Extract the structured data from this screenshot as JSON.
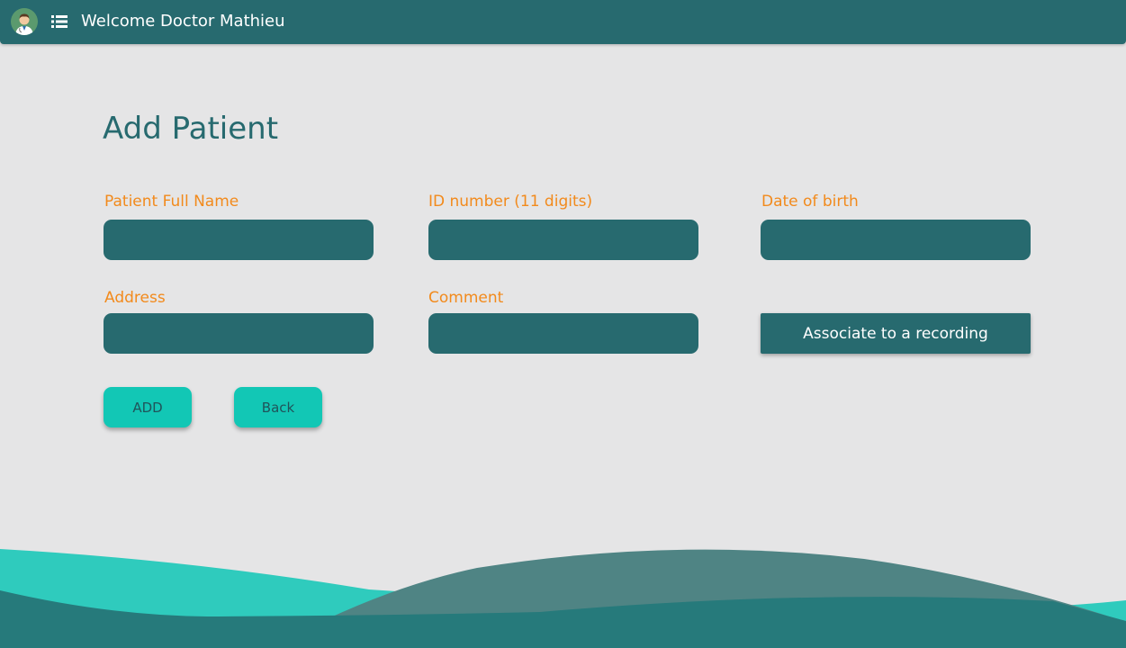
{
  "header": {
    "welcome_text": "Welcome Doctor Mathieu",
    "avatar_icon": "doctor-avatar-icon",
    "menu_icon": "list-menu-icon"
  },
  "main": {
    "title": "Add Patient",
    "fields": {
      "full_name": {
        "label": "Patient Full Name",
        "value": ""
      },
      "id_number": {
        "label": "ID number (11 digits)",
        "value": ""
      },
      "date_of_birth": {
        "label": "Date of birth",
        "value": ""
      },
      "address": {
        "label": "Address",
        "value": ""
      },
      "comment": {
        "label": "Comment",
        "value": ""
      }
    },
    "associate_button_label": "Associate to a recording",
    "add_button_label": "ADD",
    "back_button_label": "Back"
  },
  "colors": {
    "primary": "#276a6f",
    "accent": "#12c7b5",
    "label": "#f28a1c",
    "background": "#e5e5e6"
  }
}
